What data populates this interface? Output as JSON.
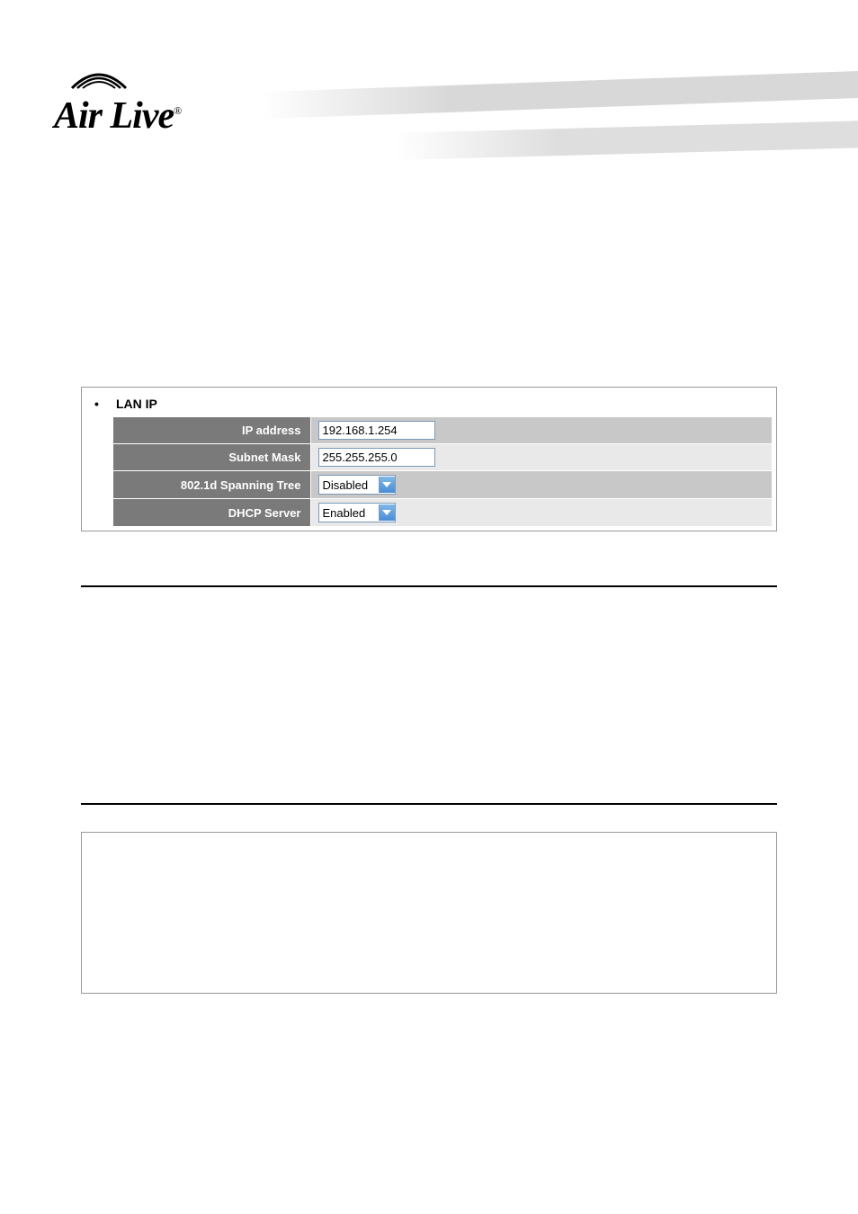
{
  "logo": {
    "brand": "Air Live",
    "registered": "®"
  },
  "lan_ip": {
    "title": "LAN IP",
    "fields": {
      "ip_address": {
        "label": "IP address",
        "value": "192.168.1.254"
      },
      "subnet_mask": {
        "label": "Subnet Mask",
        "value": "255.255.255.0"
      },
      "spanning_tree": {
        "label": "802.1d Spanning Tree",
        "value": "Disabled"
      },
      "dhcp_server": {
        "label": "DHCP Server",
        "value": "Enabled"
      }
    }
  }
}
